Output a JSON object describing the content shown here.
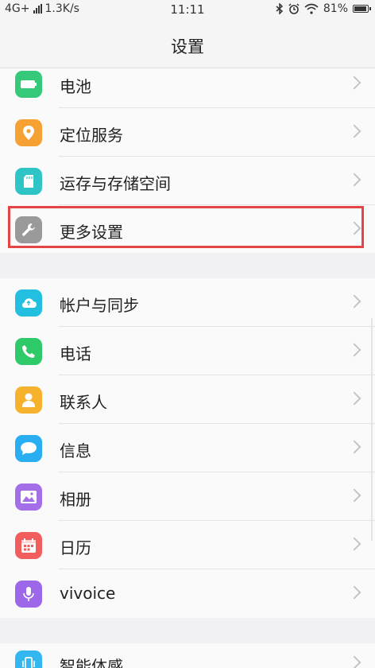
{
  "status": {
    "network": "4G+",
    "speed": "1.3K/s",
    "time": "11:11",
    "battery": "81%"
  },
  "header": {
    "title": "设置"
  },
  "group1": [
    {
      "label": "电池",
      "icon": "battery-icon",
      "color": "#36c97a"
    },
    {
      "label": "定位服务",
      "icon": "location-icon",
      "color": "#f5a133"
    },
    {
      "label": "运存与存储空间",
      "icon": "storage-icon",
      "color": "#2fc5c7"
    },
    {
      "label": "更多设置",
      "icon": "wrench-icon",
      "color": "#9a9a9a"
    }
  ],
  "group2": [
    {
      "label": "帐户与同步",
      "icon": "cloud-sync-icon",
      "color": "#22bfe0"
    },
    {
      "label": "电话",
      "icon": "phone-icon",
      "color": "#2ec968"
    },
    {
      "label": "联系人",
      "icon": "contacts-icon",
      "color": "#f6b22d"
    },
    {
      "label": "信息",
      "icon": "message-icon",
      "color": "#2aaef2"
    },
    {
      "label": "相册",
      "icon": "gallery-icon",
      "color": "#a36ee8"
    },
    {
      "label": "日历",
      "icon": "calendar-icon",
      "color": "#f25d5d"
    },
    {
      "label": "vivoice",
      "icon": "microphone-icon",
      "color": "#9d67ea"
    }
  ],
  "group3": [
    {
      "label": "智能体感",
      "icon": "motion-icon",
      "color": "#33b7f0"
    }
  ]
}
